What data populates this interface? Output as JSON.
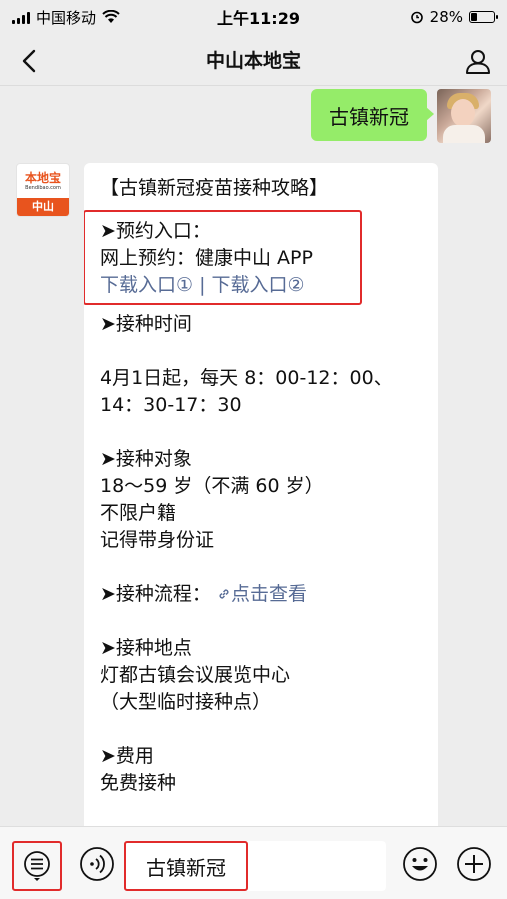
{
  "status_bar": {
    "carrier": "中国移动",
    "time": "上午11:29",
    "battery_percent": "28%",
    "battery_level": 0.28
  },
  "nav": {
    "title": "中山本地宝",
    "back_icon": "chevron-left-icon",
    "profile_icon": "person-icon"
  },
  "outgoing_message": {
    "text": "古镇新冠"
  },
  "bot": {
    "avatar_logo": "本地宝",
    "avatar_sub": "Bendibao.com",
    "avatar_city": "中山"
  },
  "message": {
    "title": "【古镇新冠疫苗接种攻略】",
    "booking": {
      "heading": "➤预约入口：",
      "online": "网上预约：健康中山 APP",
      "link1": "下载入口①",
      "separator": " | ",
      "link2": "下载入口②"
    },
    "time_heading": "➤接种时间",
    "time_line1": "4月1日起，每天 8：00-12：00、",
    "time_line2": "14：30-17：30",
    "target_heading": "➤接种对象",
    "target_line1": "18～59 岁（不满 60 岁）",
    "target_line2": "不限户籍",
    "target_line3": "记得带身份证",
    "process_heading": "➤接种流程：",
    "process_link": "点击查看",
    "location_heading": "➤接种地点",
    "location_line1": "灯都古镇会议展览中心",
    "location_line2": "（大型临时接种点）",
    "fee_heading": "➤费用",
    "fee_line1": "免费接种"
  },
  "toolbar": {
    "input_value": "古镇新冠",
    "menu_icon": "menu-list-icon",
    "voice_icon": "voice-icon",
    "emoji_icon": "emoji-icon",
    "plus_icon": "plus-icon"
  },
  "colors": {
    "outgoing_bubble": "#95ec69",
    "link": "#576b95",
    "highlight": "#e12b2b",
    "brand": "#e8541e"
  }
}
